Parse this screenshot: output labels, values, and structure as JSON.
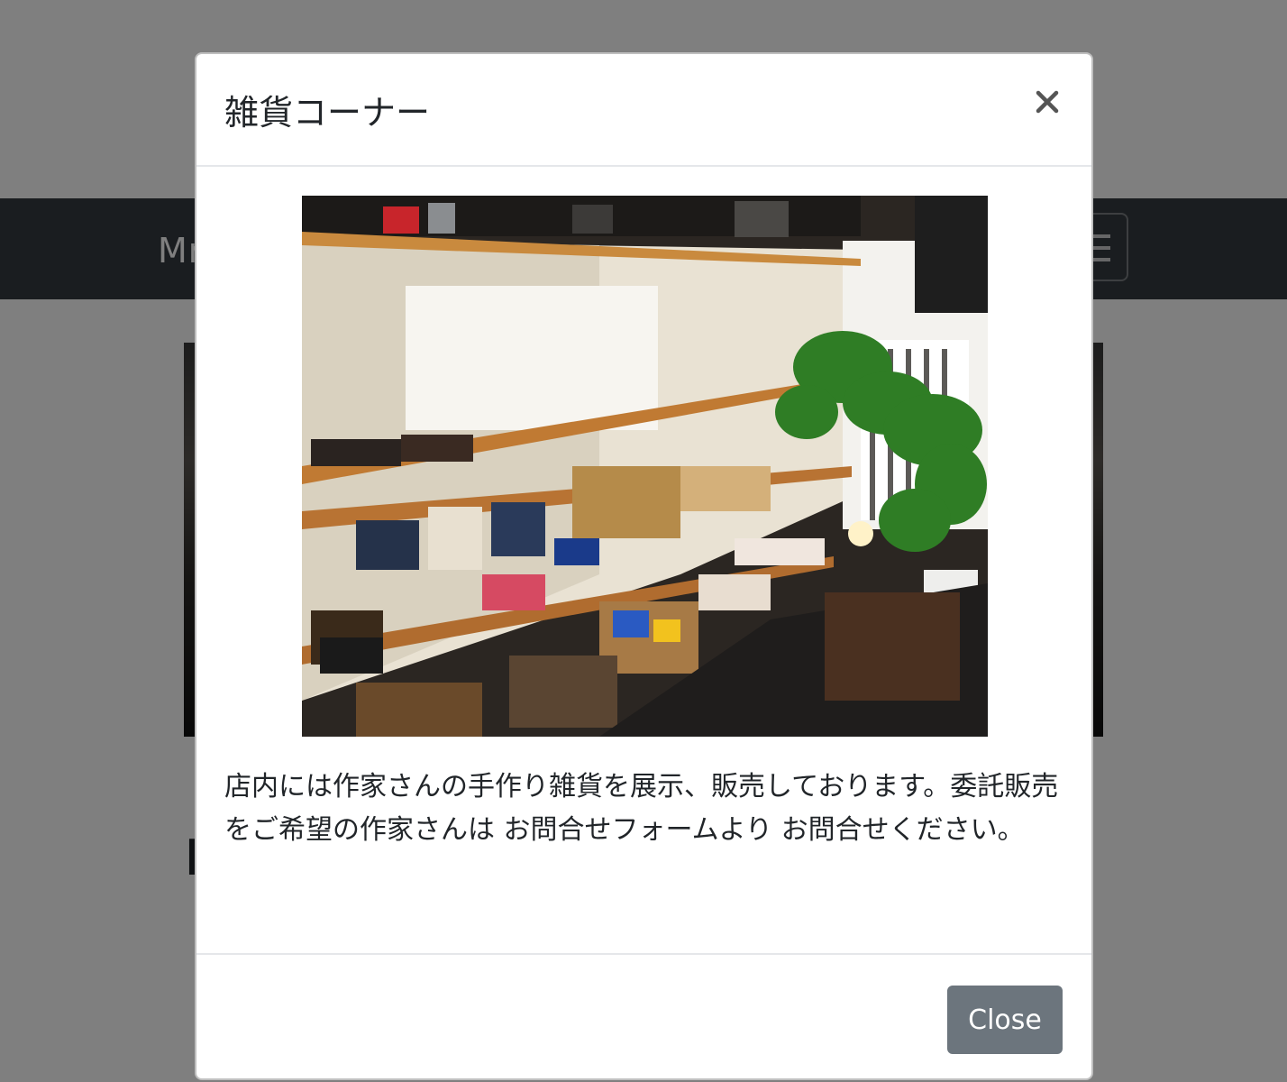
{
  "page": {
    "brand": "Mr",
    "heading": "M"
  },
  "modal": {
    "title": "雑貨コーナー",
    "close_icon": "close-icon",
    "image_alt": "",
    "description": "店内には作家さんの手作り雑貨を展示、販売しております。委託販売をご希望の作家さんは お問合せフォームより お問合せください。",
    "footer_button": "Close"
  },
  "colors": {
    "navbar": "#343a40",
    "backdrop": "rgba(0,0,0,0.5)",
    "secondary_button": "#6c757d"
  }
}
